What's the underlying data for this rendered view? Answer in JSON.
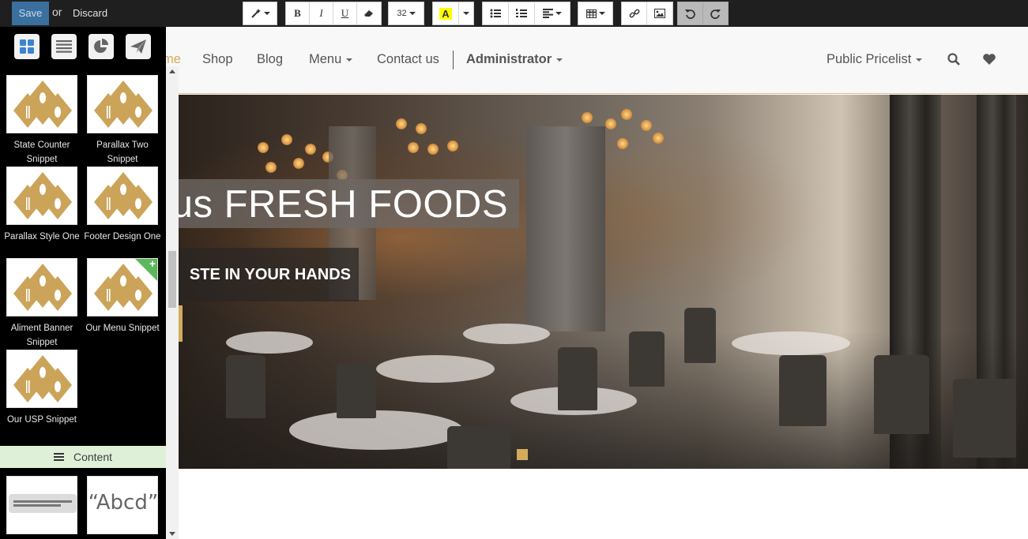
{
  "toolbar": {
    "save_label": "Save",
    "or_label": "or",
    "discard_label": "Discard",
    "font_size": "32",
    "bold": "B",
    "italic": "I",
    "underline": "U",
    "highlight": "A"
  },
  "panel": {
    "tabs": [
      "structure",
      "content",
      "features",
      "effects"
    ],
    "snippets": [
      {
        "label": "State Counter Snippet"
      },
      {
        "label": "Parallax Two Snippet"
      },
      {
        "label": "Parallax Style One"
      },
      {
        "label": "Footer Design One"
      },
      {
        "label": "Aliment Banner Snippet"
      },
      {
        "label": "Our Menu Snippet"
      },
      {
        "label": "Our USP Snippet"
      }
    ],
    "content_section": "Content",
    "content_preview_text": "Abcd"
  },
  "nav": {
    "items": [
      {
        "label": "me"
      },
      {
        "label": "Shop"
      },
      {
        "label": "Blog"
      },
      {
        "label": "Menu"
      },
      {
        "label": "Contact us"
      },
      {
        "label": "Administrator"
      },
      {
        "label": "Public Pricelist"
      }
    ]
  },
  "hero": {
    "headline": "ous FRESH FOODS",
    "subheadline": "STE IN YOUR HANDS"
  },
  "colors": {
    "accent": "#d2ab5e",
    "save": "#3a6f9e",
    "toolbar_bg": "#1f1f1f",
    "content_bar": "#dff0d8"
  }
}
